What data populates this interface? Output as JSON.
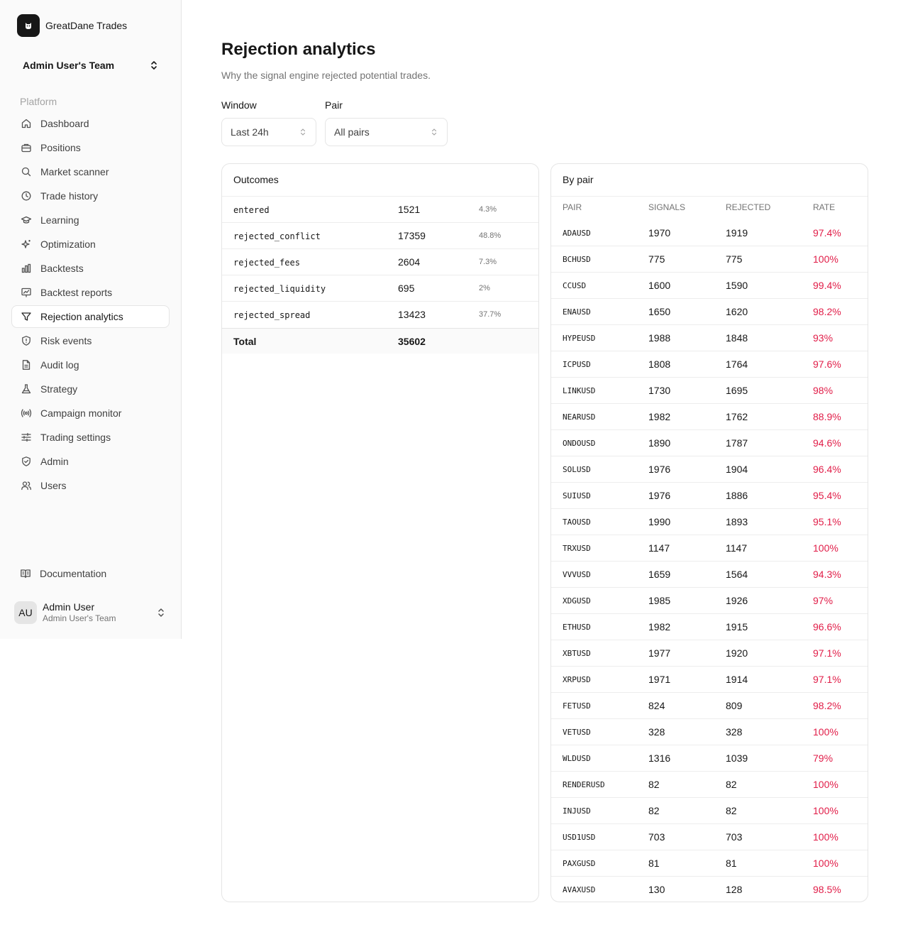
{
  "brand": {
    "name": "GreatDane Trades"
  },
  "team": {
    "name": "Admin User's Team"
  },
  "sidebar": {
    "group_label": "Platform",
    "items": [
      {
        "label": "Dashboard",
        "icon": "home-icon"
      },
      {
        "label": "Positions",
        "icon": "briefcase-icon"
      },
      {
        "label": "Market scanner",
        "icon": "search-icon"
      },
      {
        "label": "Trade history",
        "icon": "clock-icon"
      },
      {
        "label": "Learning",
        "icon": "graduation-cap-icon"
      },
      {
        "label": "Optimization",
        "icon": "sparkles-icon"
      },
      {
        "label": "Backtests",
        "icon": "bar-chart-icon"
      },
      {
        "label": "Backtest reports",
        "icon": "presentation-icon"
      },
      {
        "label": "Rejection analytics",
        "icon": "filter-icon",
        "active": true
      },
      {
        "label": "Risk events",
        "icon": "shield-alert-icon"
      },
      {
        "label": "Audit log",
        "icon": "file-text-icon"
      },
      {
        "label": "Strategy",
        "icon": "flask-icon"
      },
      {
        "label": "Campaign monitor",
        "icon": "radio-icon"
      },
      {
        "label": "Trading settings",
        "icon": "sliders-icon"
      },
      {
        "label": "Admin",
        "icon": "shield-check-icon"
      },
      {
        "label": "Users",
        "icon": "users-icon"
      }
    ],
    "docs_label": "Documentation"
  },
  "user": {
    "initials": "AU",
    "name": "Admin User",
    "team": "Admin User's Team"
  },
  "page": {
    "title": "Rejection analytics",
    "subtitle": "Why the signal engine rejected potential trades."
  },
  "filters": {
    "window_label": "Window",
    "window_value": "Last 24h",
    "pair_label": "Pair",
    "pair_value": "All pairs"
  },
  "outcomes": {
    "title": "Outcomes",
    "rows": [
      {
        "name": "entered",
        "count": "1521",
        "pct": "4.3%"
      },
      {
        "name": "rejected_conflict",
        "count": "17359",
        "pct": "48.8%"
      },
      {
        "name": "rejected_fees",
        "count": "2604",
        "pct": "7.3%"
      },
      {
        "name": "rejected_liquidity",
        "count": "695",
        "pct": "2%"
      },
      {
        "name": "rejected_spread",
        "count": "13423",
        "pct": "37.7%"
      }
    ],
    "total_label": "Total",
    "total_value": "35602"
  },
  "by_pair": {
    "title": "By pair",
    "columns": [
      "PAIR",
      "SIGNALS",
      "REJECTED",
      "RATE"
    ],
    "rows": [
      {
        "pair": "ADAUSD",
        "signals": "1970",
        "rejected": "1919",
        "rate": "97.4%"
      },
      {
        "pair": "BCHUSD",
        "signals": "775",
        "rejected": "775",
        "rate": "100%"
      },
      {
        "pair": "CCUSD",
        "signals": "1600",
        "rejected": "1590",
        "rate": "99.4%"
      },
      {
        "pair": "ENAUSD",
        "signals": "1650",
        "rejected": "1620",
        "rate": "98.2%"
      },
      {
        "pair": "HYPEUSD",
        "signals": "1988",
        "rejected": "1848",
        "rate": "93%"
      },
      {
        "pair": "ICPUSD",
        "signals": "1808",
        "rejected": "1764",
        "rate": "97.6%"
      },
      {
        "pair": "LINKUSD",
        "signals": "1730",
        "rejected": "1695",
        "rate": "98%"
      },
      {
        "pair": "NEARUSD",
        "signals": "1982",
        "rejected": "1762",
        "rate": "88.9%"
      },
      {
        "pair": "ONDOUSD",
        "signals": "1890",
        "rejected": "1787",
        "rate": "94.6%"
      },
      {
        "pair": "SOLUSD",
        "signals": "1976",
        "rejected": "1904",
        "rate": "96.4%"
      },
      {
        "pair": "SUIUSD",
        "signals": "1976",
        "rejected": "1886",
        "rate": "95.4%"
      },
      {
        "pair": "TAOUSD",
        "signals": "1990",
        "rejected": "1893",
        "rate": "95.1%"
      },
      {
        "pair": "TRXUSD",
        "signals": "1147",
        "rejected": "1147",
        "rate": "100%"
      },
      {
        "pair": "VVVUSD",
        "signals": "1659",
        "rejected": "1564",
        "rate": "94.3%"
      },
      {
        "pair": "XDGUSD",
        "signals": "1985",
        "rejected": "1926",
        "rate": "97%"
      },
      {
        "pair": "ETHUSD",
        "signals": "1982",
        "rejected": "1915",
        "rate": "96.6%"
      },
      {
        "pair": "XBTUSD",
        "signals": "1977",
        "rejected": "1920",
        "rate": "97.1%"
      },
      {
        "pair": "XRPUSD",
        "signals": "1971",
        "rejected": "1914",
        "rate": "97.1%"
      },
      {
        "pair": "FETUSD",
        "signals": "824",
        "rejected": "809",
        "rate": "98.2%"
      },
      {
        "pair": "VETUSD",
        "signals": "328",
        "rejected": "328",
        "rate": "100%"
      },
      {
        "pair": "WLDUSD",
        "signals": "1316",
        "rejected": "1039",
        "rate": "79%"
      },
      {
        "pair": "RENDERUSD",
        "signals": "82",
        "rejected": "82",
        "rate": "100%"
      },
      {
        "pair": "INJUSD",
        "signals": "82",
        "rejected": "82",
        "rate": "100%"
      },
      {
        "pair": "USD1USD",
        "signals": "703",
        "rejected": "703",
        "rate": "100%"
      },
      {
        "pair": "PAXGUSD",
        "signals": "81",
        "rejected": "81",
        "rate": "100%"
      },
      {
        "pair": "AVAXUSD",
        "signals": "130",
        "rejected": "128",
        "rate": "98.5%"
      }
    ]
  },
  "colors": {
    "rate": "#e11d48",
    "accent": "#171717",
    "muted": "#737373"
  }
}
